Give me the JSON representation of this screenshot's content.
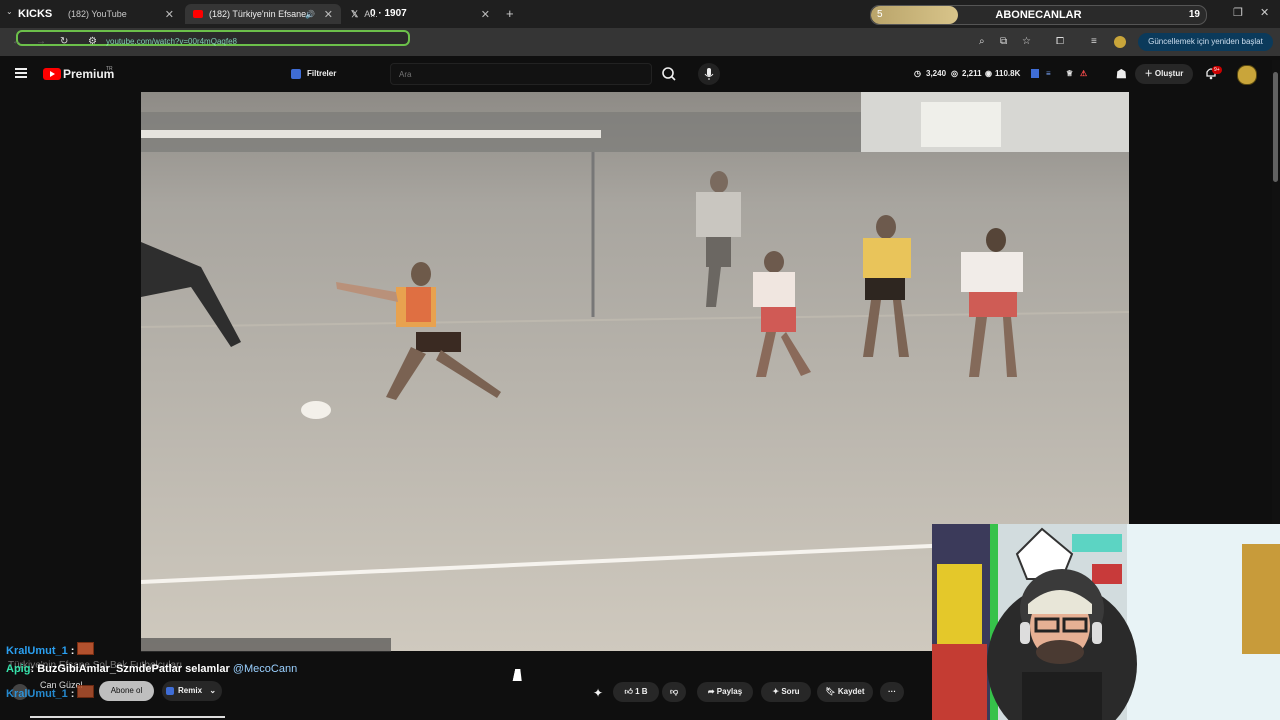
{
  "browser": {
    "overlay_label": "KICKS",
    "tabs": [
      {
        "title": "(182) YouTube"
      },
      {
        "title": "(182) Türkiye'nin Efsane So..."
      },
      {
        "title": "A..."
      }
    ],
    "x_counter": "0 · 1907",
    "new_tab": "+",
    "url": "youtube.com/watch?v=00r4mQaqfe8",
    "update_button": "Güncellemek için yeniden başlat",
    "subscriber_goal": {
      "left": "5",
      "label": "ABONECANLAR",
      "right": "19",
      "progress": 0.26
    }
  },
  "youtube": {
    "brand": "Premium",
    "region": "TR",
    "filters_label": "Filtreler",
    "search_placeholder": "Ara",
    "stats": [
      "3,240",
      "2,211",
      "110.8K"
    ],
    "create_label": "Oluştur",
    "notification_badge": "9+"
  },
  "video": {
    "title_overlay": "Türkiye'nin Efsane Sol Bek Futbolcuları"
  },
  "chat": [
    {
      "user": "KralUmut_1",
      "sep": " :",
      "message": ""
    },
    {
      "user": "Apig",
      "sep": ": ",
      "message": "BuzGibiAmlar_SzmdePatlar selamlar ",
      "mention": "@MecoCann"
    },
    {
      "user": "KralUmut_1",
      "sep": " :",
      "message": ""
    }
  ],
  "channel": {
    "name": "Can Güzel",
    "subscribe_label": "Abone ol",
    "remix_label": "Remix"
  },
  "actions": {
    "like_count": "1 B",
    "share_label": "Paylaş",
    "ask_label": "Soru",
    "save_label": "Kaydet",
    "more_label": "···"
  }
}
